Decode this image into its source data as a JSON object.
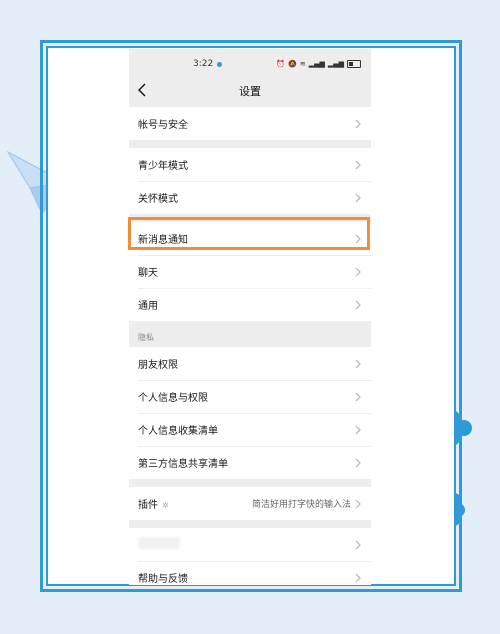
{
  "status_bar": {
    "time": "3:22"
  },
  "nav": {
    "title": "设置"
  },
  "sections": {
    "account": [
      "帐号与安全"
    ],
    "modes": [
      "青少年模式",
      "关怀模式"
    ],
    "general": [
      "新消息通知",
      "聊天",
      "通用"
    ],
    "privacy_header": "隐私",
    "privacy": [
      "朋友权限",
      "个人信息与权限",
      "个人信息收集清单",
      "第三方信息共享清单"
    ],
    "plugins": {
      "label": "插件",
      "value": "简洁好用打字快的输入法"
    },
    "help": "帮助与反馈"
  },
  "colors": {
    "frame": "#2f9bd6",
    "highlight": "#f08c3a",
    "background": "#e3eef9"
  },
  "highlighted_item": "新消息通知"
}
